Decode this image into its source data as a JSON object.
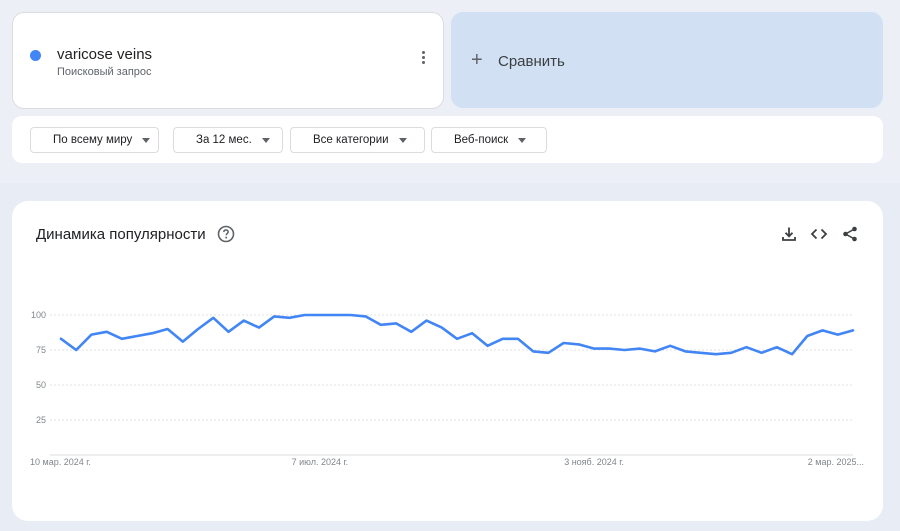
{
  "term": {
    "name": "varicose veins",
    "subtitle": "Поисковый запрос",
    "color": "#4285f4"
  },
  "compare": {
    "label": "Сравнить",
    "icon": "plus-icon"
  },
  "filters": {
    "region": "По всему миру",
    "period": "За 12 мес.",
    "category": "Все категории",
    "search_type": "Веб-поиск"
  },
  "chart": {
    "title": "Динамика популярности",
    "icons": [
      "help-icon",
      "download-icon",
      "embed-code-icon",
      "share-icon"
    ]
  },
  "chart_data": {
    "type": "line",
    "title": "Динамика популярности",
    "ylim": [
      0,
      100
    ],
    "yticks": [
      "100",
      "75",
      "50",
      "25"
    ],
    "xtick_labels": [
      "10 мар. 2024 г.",
      "7 июл. 2024 г.",
      "3 нояб. 2024 г.",
      "2 мар. 2025..."
    ],
    "grid": true,
    "series": [
      {
        "name": "varicose veins",
        "color": "#4285f4",
        "values": [
          83,
          75,
          86,
          88,
          83,
          85,
          87,
          90,
          81,
          90,
          98,
          88,
          96,
          91,
          99,
          98,
          100,
          100,
          100,
          100,
          99,
          93,
          94,
          88,
          96,
          91,
          83,
          87,
          78,
          83,
          83,
          74,
          73,
          80,
          79,
          76,
          76,
          75,
          76,
          74,
          78,
          74,
          73,
          72,
          73,
          77,
          73,
          77,
          72,
          85,
          89,
          86,
          89
        ]
      }
    ]
  }
}
